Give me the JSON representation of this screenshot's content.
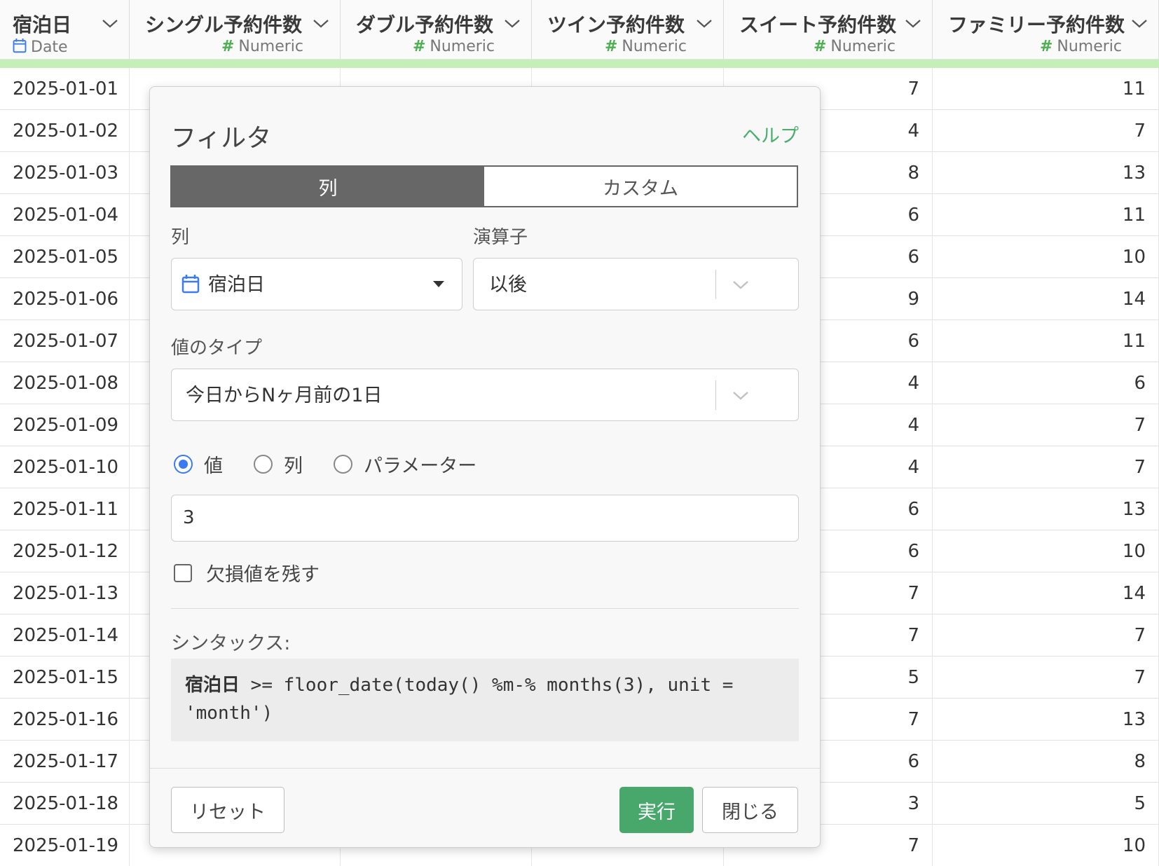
{
  "columns": [
    {
      "name": "宿泊日",
      "type": "Date",
      "type_icon": "calendar-icon"
    },
    {
      "name": "シングル予約件数",
      "type": "Numeric",
      "type_icon": "hash-icon"
    },
    {
      "name": "ダブル予約件数",
      "type": "Numeric",
      "type_icon": "hash-icon"
    },
    {
      "name": "ツイン予約件数",
      "type": "Numeric",
      "type_icon": "hash-icon"
    },
    {
      "name": "スイート予約件数",
      "type": "Numeric",
      "type_icon": "hash-icon"
    },
    {
      "name": "ファミリー予約件数",
      "type": "Numeric",
      "type_icon": "hash-icon"
    }
  ],
  "rows": [
    [
      "2025-01-01",
      "",
      "",
      "",
      "7",
      "11"
    ],
    [
      "2025-01-02",
      "",
      "",
      "",
      "4",
      "7"
    ],
    [
      "2025-01-03",
      "",
      "",
      "",
      "8",
      "13"
    ],
    [
      "2025-01-04",
      "",
      "",
      "",
      "6",
      "11"
    ],
    [
      "2025-01-05",
      "",
      "",
      "",
      "6",
      "10"
    ],
    [
      "2025-01-06",
      "",
      "",
      "",
      "9",
      "14"
    ],
    [
      "2025-01-07",
      "",
      "",
      "",
      "6",
      "11"
    ],
    [
      "2025-01-08",
      "",
      "",
      "",
      "4",
      "6"
    ],
    [
      "2025-01-09",
      "",
      "",
      "",
      "4",
      "7"
    ],
    [
      "2025-01-10",
      "",
      "",
      "",
      "4",
      "7"
    ],
    [
      "2025-01-11",
      "",
      "",
      "",
      "6",
      "13"
    ],
    [
      "2025-01-12",
      "",
      "",
      "",
      "6",
      "10"
    ],
    [
      "2025-01-13",
      "",
      "",
      "",
      "7",
      "14"
    ],
    [
      "2025-01-14",
      "",
      "",
      "",
      "7",
      "7"
    ],
    [
      "2025-01-15",
      "",
      "",
      "",
      "5",
      "7"
    ],
    [
      "2025-01-16",
      "",
      "",
      "",
      "7",
      "13"
    ],
    [
      "2025-01-17",
      "",
      "",
      "",
      "6",
      "8"
    ],
    [
      "2025-01-18",
      "",
      "",
      "",
      "3",
      "5"
    ],
    [
      "2025-01-19",
      "",
      "",
      "",
      "7",
      "10"
    ]
  ],
  "dialog": {
    "title": "フィルタ",
    "help_link": "ヘルプ",
    "tabs": [
      "列",
      "カスタム"
    ],
    "active_tab": "列",
    "column_label": "列",
    "column_value": "宿泊日",
    "operator_label": "演算子",
    "operator_value": "以後",
    "value_type_label": "値のタイプ",
    "value_type_value": "今日からNヶ月前の1日",
    "radio_options": [
      "値",
      "列",
      "パラメーター"
    ],
    "radio_selected": "値",
    "value_input": "3",
    "keep_na_label": "欠損値を残す",
    "keep_na_checked": false,
    "syntax_label": "シンタックス:",
    "syntax_column": "宿泊日",
    "syntax_rest_line1": " >= floor_date(today() %m-% months(3), unit =",
    "syntax_line2": "'month')",
    "reset_button": "リセット",
    "run_button": "実行",
    "close_button": "閉じる"
  },
  "colors": {
    "accent_green": "#48a86c",
    "help_green": "#4caf6e",
    "radio_blue": "#3a7bf2",
    "filter_bar": "#c5efb9",
    "active_tab": "#676767"
  }
}
